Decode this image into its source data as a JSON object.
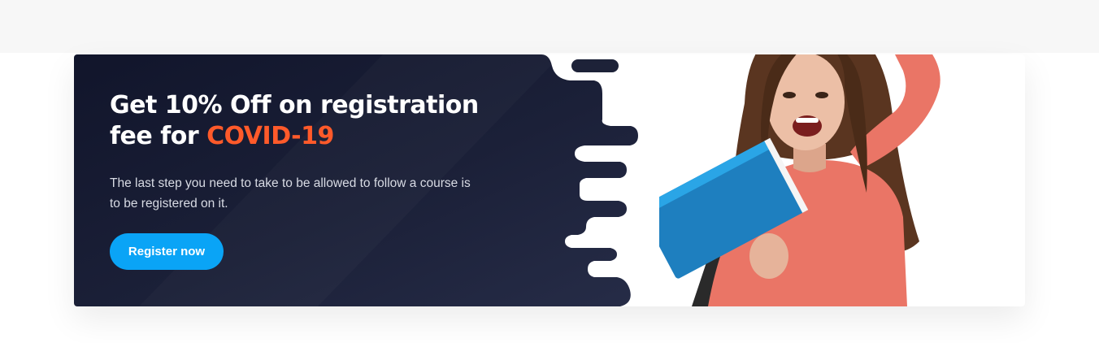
{
  "promo": {
    "headline_main": "Get 10% Off on registration fee for ",
    "headline_accent": "COVID-19",
    "description": "The last step you need to take to be allowed to follow a course is to be registered on it.",
    "cta_label": "Register now"
  },
  "colors": {
    "card_dark": "#1b2038",
    "accent_orange": "#ff5a2a",
    "button_blue": "#0aa4f6",
    "hoodie": "#ea7566"
  },
  "image": {
    "subject": "smiling-student-with-book"
  }
}
